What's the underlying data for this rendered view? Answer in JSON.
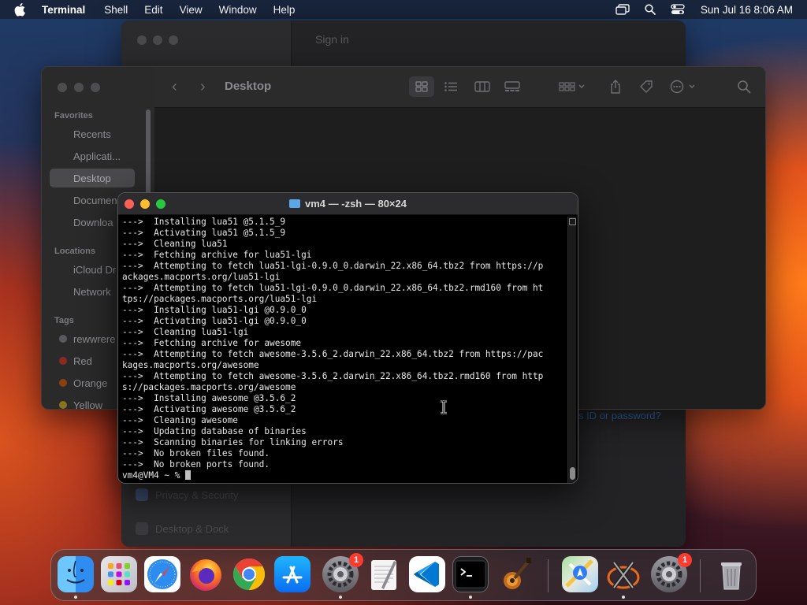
{
  "menubar": {
    "app_name": "Terminal",
    "menus": [
      "Shell",
      "Edit",
      "View",
      "Window",
      "Help"
    ],
    "clock": "Sun Jul 16  8:06 AM"
  },
  "settings_window": {
    "signin_label": "Sign in",
    "password_link": "s ID or password?",
    "sidebar_rows": [
      "Privacy & Security",
      "Desktop & Dock"
    ]
  },
  "finder": {
    "title": "Desktop",
    "sections": {
      "favorites": "Favorites",
      "locations": "Locations",
      "tags": "Tags"
    },
    "favorites": [
      "Recents",
      "Applicati...",
      "Desktop",
      "Documen",
      "Downloa"
    ],
    "locations": [
      "iCloud Dr",
      "Network"
    ],
    "tags": [
      {
        "label": "rewwrere",
        "color": "#5a5a5e"
      },
      {
        "label": "Red",
        "color": "#c0392b"
      },
      {
        "label": "Orange",
        "color": "#d35400"
      },
      {
        "label": "Yellow",
        "color": "#c9a227"
      }
    ]
  },
  "terminal": {
    "title": "vm4 — -zsh — 80×24",
    "lines": [
      "--->  Installing lua51 @5.1.5_9",
      "--->  Activating lua51 @5.1.5_9",
      "--->  Cleaning lua51",
      "--->  Fetching archive for lua51-lgi",
      "--->  Attempting to fetch lua51-lgi-0.9.0_0.darwin_22.x86_64.tbz2 from https://p",
      "ackages.macports.org/lua51-lgi",
      "--->  Attempting to fetch lua51-lgi-0.9.0_0.darwin_22.x86_64.tbz2.rmd160 from ht",
      "tps://packages.macports.org/lua51-lgi",
      "--->  Installing lua51-lgi @0.9.0_0",
      "--->  Activating lua51-lgi @0.9.0_0",
      "--->  Cleaning lua51-lgi",
      "--->  Fetching archive for awesome",
      "--->  Attempting to fetch awesome-3.5.6_2.darwin_22.x86_64.tbz2 from https://pac",
      "kages.macports.org/awesome",
      "--->  Attempting to fetch awesome-3.5.6_2.darwin_22.x86_64.tbz2.rmd160 from http",
      "s://packages.macports.org/awesome",
      "--->  Installing awesome @3.5.6_2",
      "--->  Activating awesome @3.5.6_2",
      "--->  Cleaning awesome",
      "--->  Updating database of binaries",
      "--->  Scanning binaries for linking errors",
      "--->  No broken files found.",
      "--->  No broken ports found."
    ],
    "prompt": "vm4@VM4 ~ % "
  },
  "dock": {
    "apps": [
      {
        "name": "finder",
        "icon": "finder-icon"
      },
      {
        "name": "launchpad",
        "icon": "launchpad-icon"
      },
      {
        "name": "safari",
        "icon": "safari-icon"
      },
      {
        "name": "firefox",
        "icon": "firefox-icon"
      },
      {
        "name": "chrome",
        "icon": "chrome-icon"
      },
      {
        "name": "app-store",
        "icon": "app-store-icon"
      },
      {
        "name": "system-settings",
        "icon": "gear-icon",
        "badge": "1"
      },
      {
        "name": "textedit",
        "icon": "textedit-icon"
      },
      {
        "name": "vscode",
        "icon": "vscode-icon"
      },
      {
        "name": "terminal",
        "icon": "terminal-icon"
      },
      {
        "name": "instruments",
        "icon": "guitar-icon"
      },
      {
        "name": "maps",
        "icon": "maps-icon"
      },
      {
        "name": "xquartz",
        "icon": "xquartz-icon"
      },
      {
        "name": "system-settings-2",
        "icon": "gear-icon",
        "badge": "1"
      },
      {
        "name": "trash",
        "icon": "trash-icon"
      }
    ]
  }
}
